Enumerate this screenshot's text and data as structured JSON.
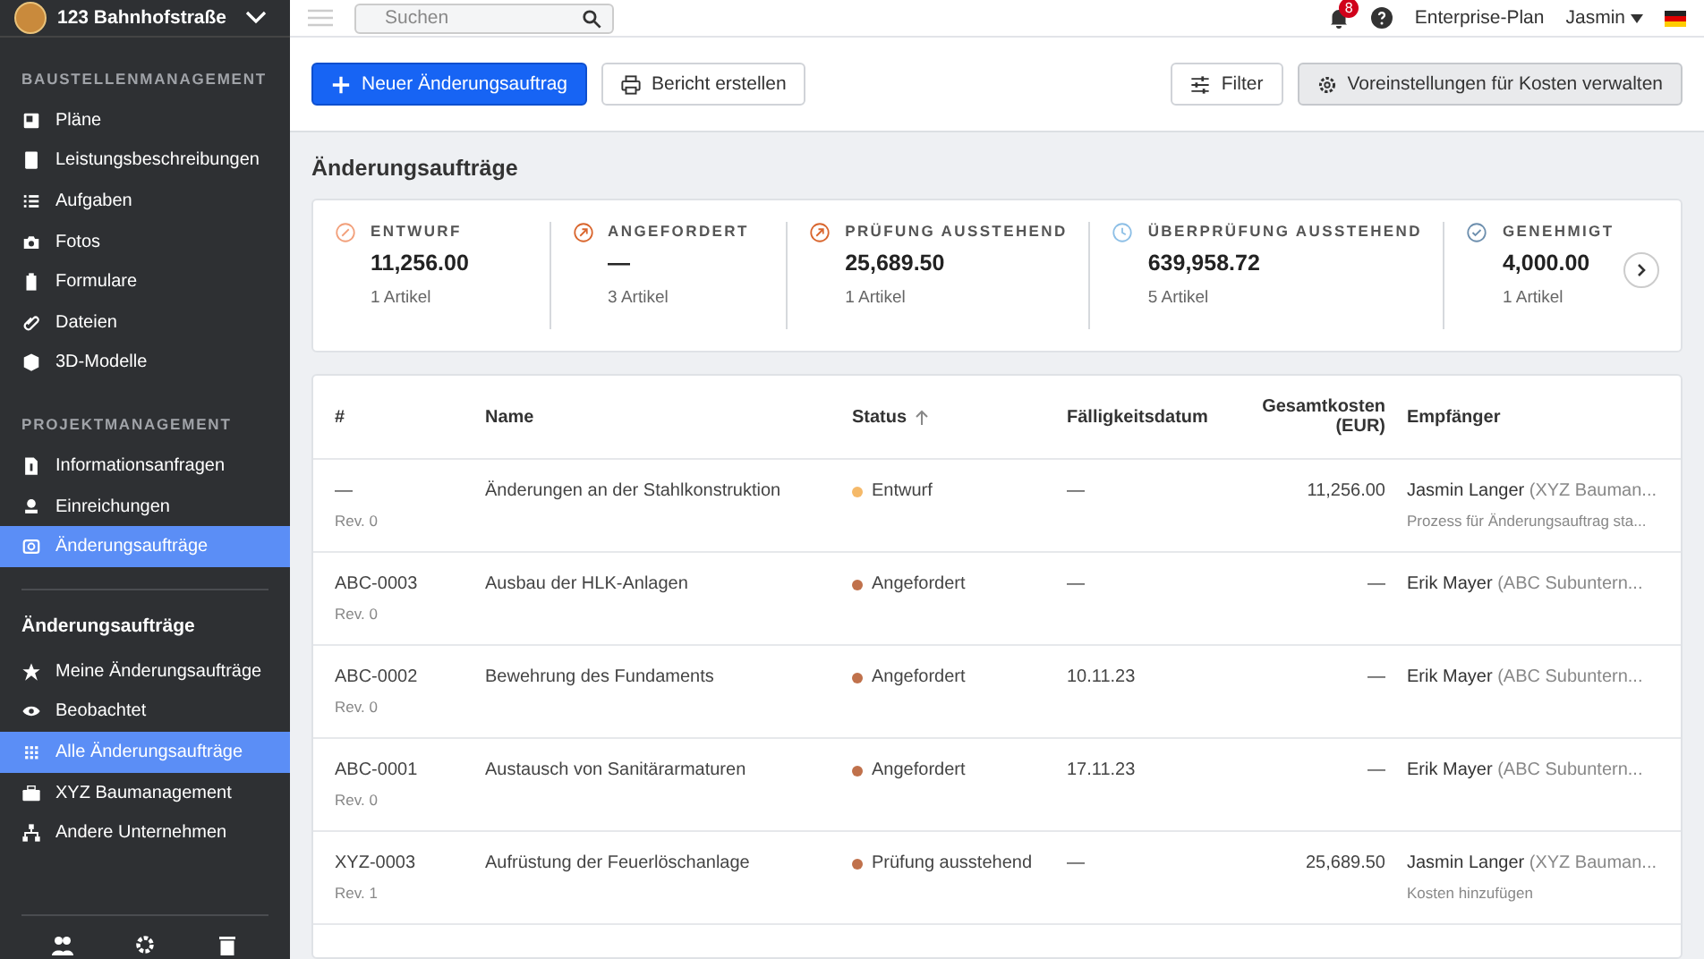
{
  "project": {
    "name": "123 Bahnhofstraße"
  },
  "sidebar": {
    "sections": [
      {
        "title": "BAUSTELLENMANAGEMENT",
        "items": [
          {
            "label": "Pläne",
            "selected": false
          },
          {
            "label": "Leistungsbeschreibungen",
            "selected": false
          },
          {
            "label": "Aufgaben",
            "selected": false
          },
          {
            "label": "Fotos",
            "selected": false
          },
          {
            "label": "Formulare",
            "selected": false
          },
          {
            "label": "Dateien",
            "selected": false
          },
          {
            "label": "3D-Modelle",
            "selected": false
          }
        ]
      },
      {
        "title": "PROJEKTMANAGEMENT",
        "items": [
          {
            "label": "Informationsanfragen",
            "selected": false
          },
          {
            "label": "Einreichungen",
            "selected": false
          },
          {
            "label": "Änderungsaufträge",
            "selected": true
          }
        ]
      }
    ],
    "sub_title": "Änderungsaufträge",
    "sub_items": [
      {
        "label": "Meine Änderungsaufträge",
        "selected": false
      },
      {
        "label": "Beobachtet",
        "selected": false
      },
      {
        "label": "Alle Änderungsaufträge",
        "selected": true
      },
      {
        "label": "XYZ Baumanagement",
        "selected": false
      },
      {
        "label": "Andere Unternehmen",
        "selected": false
      }
    ]
  },
  "topbar": {
    "search": {
      "placeholder": "Suchen"
    },
    "notifications": "8",
    "plan": "Enterprise-Plan",
    "user": "Jasmin"
  },
  "toolbar": {
    "new_button": "Neuer Änderungsauftrag",
    "report_button": "Bericht erstellen",
    "filter_button": "Filter",
    "settings_button": "Voreinstellungen für Kosten verwalten"
  },
  "page_title": "Änderungsaufträge",
  "summary": [
    {
      "label": "ENTWURF",
      "value": "11,256.00",
      "count": "1 Artikel",
      "kind": "draft",
      "color": "#f2a07b"
    },
    {
      "label": "ANGEFORDERT",
      "value": "—",
      "count": "3 Artikel",
      "kind": "requested",
      "color": "#d9662e"
    },
    {
      "label": "PRÜFUNG AUSSTEHEND",
      "value": "25,689.50",
      "count": "1 Artikel",
      "kind": "requested",
      "color": "#d9662e"
    },
    {
      "label": "ÜBERPRÜFUNG AUSSTEHEND",
      "value": "639,958.72",
      "count": "5 Artikel",
      "kind": "pending",
      "color": "#8dbfe6"
    },
    {
      "label": "GENEHMIGT",
      "value": "4,000.00",
      "count": "1 Artikel",
      "kind": "approved",
      "color": "#6d8fae"
    }
  ],
  "table": {
    "columns": [
      "#",
      "Name",
      "Status",
      "Fälligkeitsdatum",
      "Gesamtkosten (EUR)",
      "Empfänger"
    ],
    "rows": [
      {
        "number": "—",
        "revision": "Rev. 0",
        "name": "Änderungen an der Stahlkonstruktion",
        "status": "Entwurf",
        "color": "#f5b969",
        "due": "—",
        "cost": "11,256.00",
        "recipient": "Jasmin Langer",
        "company": "(XYZ Bauman...",
        "note": "Prozess für Änderungsauftrag sta..."
      },
      {
        "number": "ABC-0003",
        "revision": "Rev. 0",
        "name": "Ausbau der HLK-Anlagen",
        "status": "Angefordert",
        "color": "#c0714b",
        "due": "—",
        "cost": "—",
        "recipient": "Erik Mayer",
        "company": "(ABC Subuntern..."
      },
      {
        "number": "ABC-0002",
        "revision": "Rev. 0",
        "name": "Bewehrung des Fundaments",
        "status": "Angefordert",
        "color": "#c0714b",
        "due": "10.11.23",
        "cost": "—",
        "recipient": "Erik Mayer",
        "company": "(ABC Subuntern..."
      },
      {
        "number": "ABC-0001",
        "revision": "Rev. 0",
        "name": "Austausch von Sanitärarmaturen",
        "status": "Angefordert",
        "color": "#c0714b",
        "due": "17.11.23",
        "cost": "—",
        "recipient": "Erik Mayer",
        "company": "(ABC Subuntern..."
      },
      {
        "number": "XYZ-0003",
        "revision": "Rev. 1",
        "name": "Aufrüstung der Feuerlöschanlage",
        "status": "Prüfung ausstehend",
        "color": "#c0714b",
        "due": "—",
        "cost": "25,689.50",
        "recipient": "Jasmin Langer",
        "company": "(XYZ Bauman...",
        "note": "Kosten hinzufügen"
      }
    ]
  }
}
